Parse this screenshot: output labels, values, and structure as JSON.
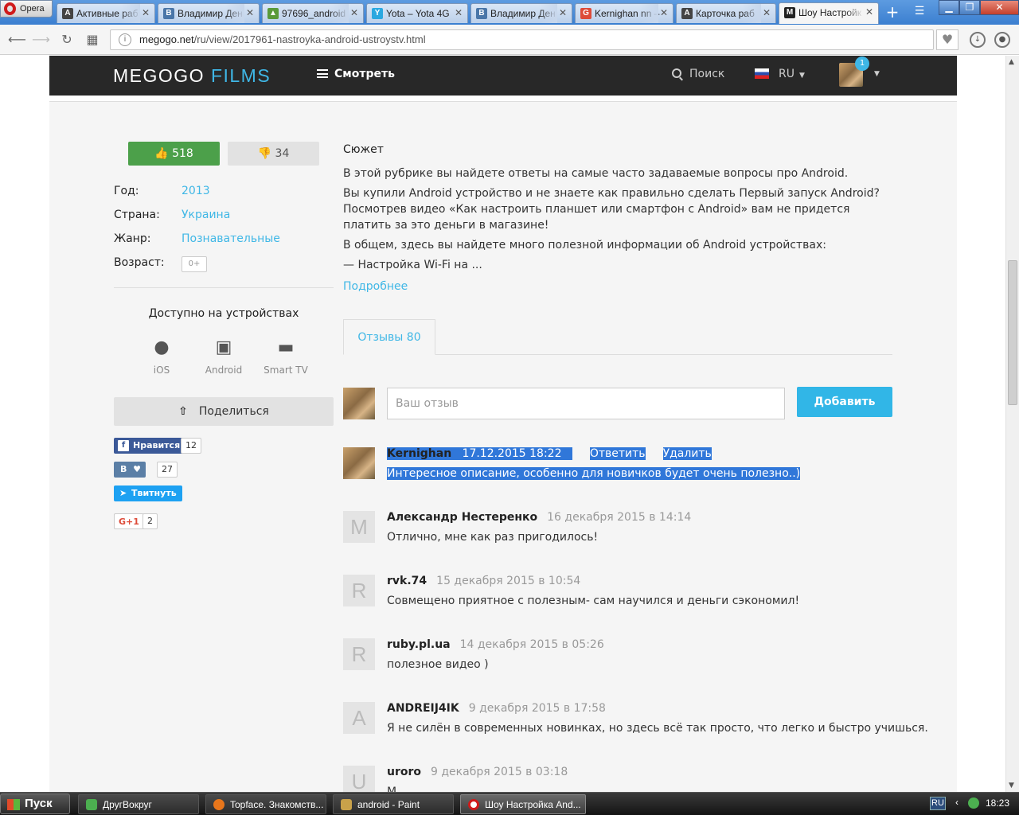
{
  "browser": {
    "menu_label": "Opera",
    "tabs": [
      {
        "title": "Активные раб",
        "icon": "A",
        "color": "#444444"
      },
      {
        "title": "Владимир Ден",
        "icon": "B",
        "color": "#4a76a8"
      },
      {
        "title": "97696_android",
        "icon": "▲",
        "color": "#5a9a3a"
      },
      {
        "title": "Yota – Yota 4G",
        "icon": "Y",
        "color": "#2aa8e0"
      },
      {
        "title": "Владимир Ден",
        "icon": "B",
        "color": "#4a76a8"
      },
      {
        "title": "Kernighan nn –",
        "icon": "G",
        "color": "#dd4b39"
      },
      {
        "title": "Карточка раб",
        "icon": "A",
        "color": "#444444"
      },
      {
        "title": "Шоу Настройк",
        "icon": "M",
        "color": "#222222",
        "active": true
      }
    ],
    "new_tab_label": "+",
    "url_host": "megogo.net",
    "url_path": "/ru/view/2017961-nastroyka-android-ustroystv.html"
  },
  "site": {
    "logo_main": "MEGOGO",
    "logo_accent": "FILMS",
    "menu_label": "Смотреть",
    "search_label": "Поиск",
    "lang": "RU",
    "notif_count": "1"
  },
  "movie": {
    "likes": "518",
    "dislikes": "34",
    "info": [
      {
        "key": "Год:",
        "value": "2013"
      },
      {
        "key": "Страна:",
        "value": "Украина"
      },
      {
        "key": "Жанр:",
        "value": "Познавательные"
      },
      {
        "key": "Возраст:",
        "value": "0+"
      }
    ],
    "devices_title": "Доступно на устройствах",
    "devices": [
      "iOS",
      "Android",
      "Smart TV"
    ],
    "share_label": "Поделиться",
    "social": {
      "fb_label": "Нравится",
      "fb_count": "12",
      "vk_label": "В",
      "vk_count": "27",
      "tw_label": "Твитнуть",
      "gplus_label": "G+1",
      "gplus_count": "2"
    },
    "synopsis_title": "Сюжет",
    "synopsis": [
      "В этой рубрике вы найдете ответы на самые часто задаваемые вопросы про Android.",
      "Вы купили Android устройство и не знаете как правильно сделать Первый запуск Android? Посмотрев видео «Как настроить планшет или смартфон с Android» вам не придется платить за это деньги в магазине!",
      "В общем, здесь вы найдете много полезной информации об Android устройствах:",
      "— Настройка Wi-Fi на ..."
    ],
    "more_label": "Подробнее"
  },
  "reviews": {
    "tab_label": "Отзывы 80",
    "input_placeholder": "Ваш отзыв",
    "add_label": "Добавить",
    "own": {
      "author": "Kernighan",
      "date": "17.12.2015 18:22",
      "reply_label": "Ответить",
      "delete_label": "Удалить",
      "text": "Интересное описание, особенно для новичков будет очень полезно..)"
    },
    "list": [
      {
        "letter": "M",
        "author": "Александр Нестеренко",
        "date": "16 декабря 2015 в 14:14",
        "text": "Отлично, мне как раз пригодилось!"
      },
      {
        "letter": "R",
        "author": "rvk.74",
        "date": "15 декабря 2015 в 10:54",
        "text": "Совмещено приятное с полезным- сам научился и деньги сэкономил!"
      },
      {
        "letter": "R",
        "author": "ruby.pl.ua",
        "date": "14 декабря 2015 в 05:26",
        "text": "полезное видео )"
      },
      {
        "letter": "A",
        "author": "ANDREIJ4IK",
        "date": "9 декабря 2015 в 17:58",
        "text": "Я не силён в современных новинках, но здесь всё так просто, что легко и быстро учишься."
      },
      {
        "letter": "U",
        "author": "uroro",
        "date": "9 декабря 2015 в 03:18",
        "text": "М"
      }
    ]
  },
  "taskbar": {
    "start_label": "Пуск",
    "tasks": [
      {
        "label": "ДругВокруг",
        "color": "#4caf50"
      },
      {
        "label": "Topface. Знакомств...",
        "color": "#e8761b"
      },
      {
        "label": "android - Paint",
        "color": "#c9a24a"
      },
      {
        "label": "Шоу Настройка And...",
        "color": "#d01a1a",
        "active": true
      }
    ],
    "lang": "RU",
    "clock": "18:23"
  }
}
